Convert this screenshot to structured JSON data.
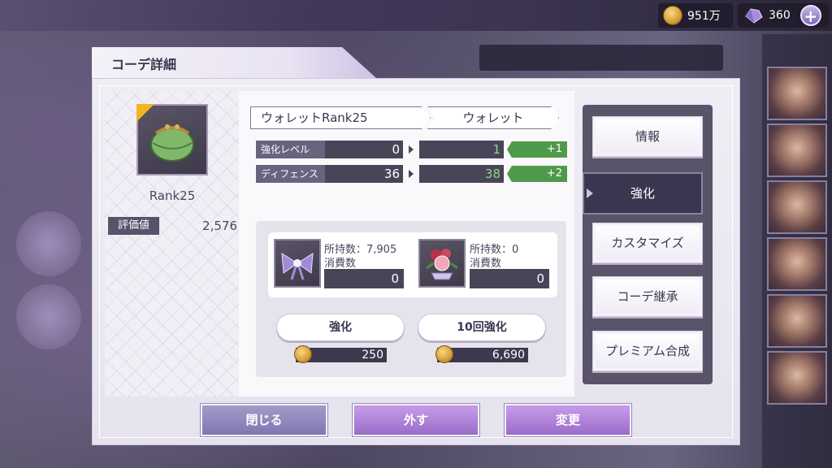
{
  "currency": {
    "coins": "951万",
    "gems": "360"
  },
  "modal": {
    "title": "コーデ詳細"
  },
  "item": {
    "rank_label": "Rank25",
    "evaluation_label": "評価値",
    "evaluation_value": "2,576"
  },
  "names": {
    "current": "ウォレットRank25",
    "next": "ウォレット"
  },
  "stats": [
    {
      "label": "強化レベル",
      "current": "0",
      "next": "1",
      "diff": "+1"
    },
    {
      "label": "ディフェンス",
      "current": "36",
      "next": "38",
      "diff": "+2"
    }
  ],
  "materials": [
    {
      "owned_label": "所持数：7,905",
      "consume_label": "消費数",
      "consume_value": "0"
    },
    {
      "owned_label": "所持数：0",
      "consume_label": "消費数",
      "consume_value": "0"
    }
  ],
  "actions": {
    "enhance_label": "強化",
    "enhance_cost": "250",
    "enhance10_label": "10回強化",
    "enhance10_cost": "6,690"
  },
  "side_menu": [
    {
      "label": "情報",
      "active": false
    },
    {
      "label": "強化",
      "active": true
    },
    {
      "label": "カスタマイズ",
      "active": false
    },
    {
      "label": "コーデ継承",
      "active": false
    },
    {
      "label": "プレミアム合成",
      "active": false
    }
  ],
  "bottom": {
    "close": "閉じる",
    "remove": "外す",
    "change": "変更"
  },
  "colors": {
    "stat_bar": "#4a4458",
    "stat_up": "#7ee07a",
    "diff_badge": "#4f9a4a",
    "rarity_corner": "#f2b420",
    "button_grey": "#7f77b0",
    "button_purple": "#9b6cc9"
  },
  "icons": {
    "coin": "gold-coin-icon",
    "gem": "purple-crystal-icon",
    "item": "green-coin-purse-icon",
    "material_1": "purple-ribbon-icon",
    "material_2": "rose-corsage-icon"
  }
}
